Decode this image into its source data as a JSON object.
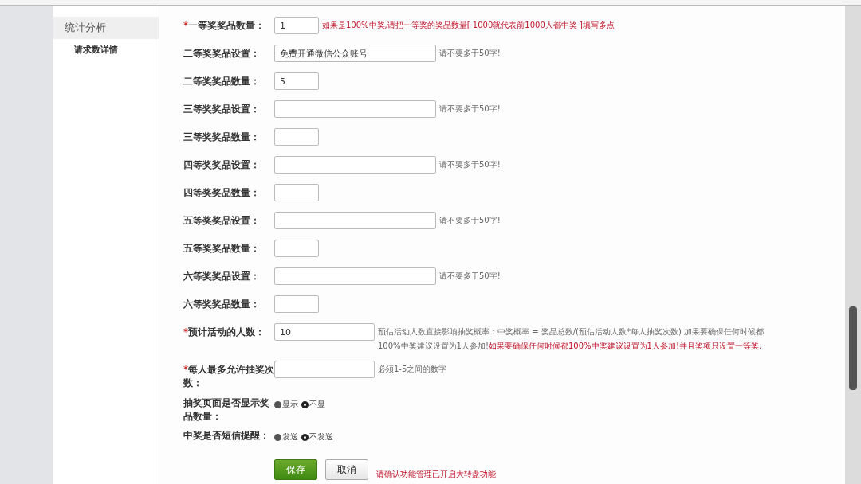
{
  "sidebar": {
    "items": [
      {
        "label": "统计分析",
        "selected": true,
        "kind": "section"
      },
      {
        "label": "请求数详情",
        "selected": false,
        "kind": "sub"
      }
    ]
  },
  "form": {
    "rows": [
      {
        "marker": "*",
        "label": "一等奖奖品数量：",
        "kind": "short",
        "value": "1",
        "hint": [
          {
            "text": "如果是100%中奖,请把一等奖的奖品数量[ 1000就代表前1000人都中奖 ]填写多点",
            "kind": "warn"
          }
        ]
      },
      {
        "label": "二等奖奖品设置：",
        "kind": "long",
        "value": "免费开通微信公众账号",
        "hint": [
          {
            "text": "请不要多于50字!",
            "kind": "note"
          }
        ]
      },
      {
        "label": "二等奖奖品数量：",
        "kind": "short",
        "value": "5"
      },
      {
        "label": "三等奖奖品设置：",
        "kind": "long",
        "hint": [
          {
            "text": "请不要多于50字!",
            "kind": "note"
          }
        ]
      },
      {
        "label": "三等奖奖品数量：",
        "kind": "short"
      },
      {
        "label": "四等奖奖品设置：",
        "kind": "long",
        "hint": [
          {
            "text": "请不要多于50字!",
            "kind": "note"
          }
        ]
      },
      {
        "label": "四等奖奖品数量：",
        "kind": "short"
      },
      {
        "label": "五等奖奖品设置：",
        "kind": "long",
        "hint": [
          {
            "text": "请不要多于50字!",
            "kind": "note"
          }
        ]
      },
      {
        "label": "五等奖奖品数量：",
        "kind": "short"
      },
      {
        "label": "六等奖奖品设置：",
        "kind": "long",
        "hint": [
          {
            "text": "请不要多于50字!",
            "kind": "note"
          }
        ]
      },
      {
        "label": "六等奖奖品数量：",
        "kind": "short"
      },
      {
        "marker": "*",
        "label": "预计活动的人数：",
        "kind": "medium",
        "value": "10",
        "hint": [
          {
            "text": "预估活动人数直接影响抽奖概率：中奖概率 = 奖品总数/(预估活动人数*每人抽奖次数) 加果要确保任何时候都100%中奖建议设置为1人参加!",
            "kind": "note"
          },
          {
            "text": "如果要确保任何时候都100%中奖建议设置为1人参加!并且奖项只设置一等奖.",
            "kind": "warn"
          }
        ]
      },
      {
        "marker": "*",
        "label": "每人最多允许抽奖次数：",
        "kind": "medium",
        "hint": [
          {
            "text": "必须1-5之间的数字",
            "kind": "note"
          }
        ]
      },
      {
        "label": "抽奖页面是否显示奖品数量：",
        "kind": "radio",
        "options": [
          {
            "label": "显示",
            "selected": false
          },
          {
            "label": "不显",
            "selected": true
          }
        ]
      },
      {
        "label": "中奖是否短信提醒：",
        "kind": "radio",
        "options": [
          {
            "label": "发送",
            "selected": false
          },
          {
            "label": "不发送",
            "selected": true
          }
        ]
      }
    ],
    "buttons": [
      {
        "label": "保存",
        "kind": "primary"
      },
      {
        "label": "取消",
        "kind": "secondary"
      }
    ],
    "footer_note": "请确认功能管理已开启大转盘功能"
  }
}
